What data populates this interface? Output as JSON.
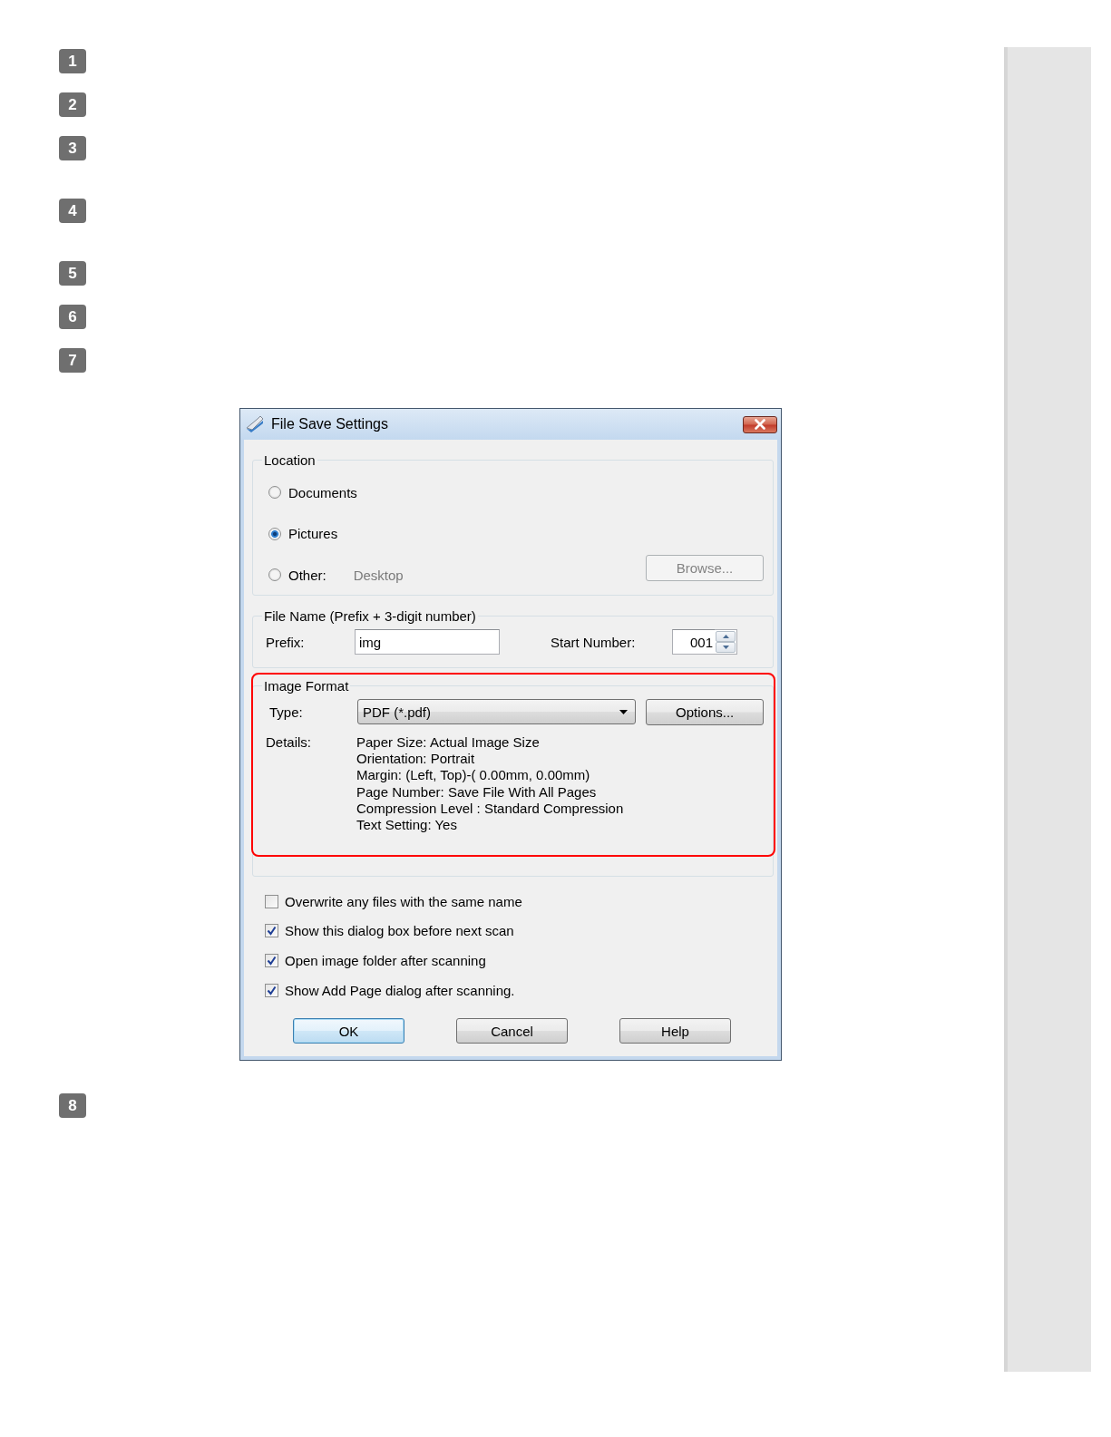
{
  "steps": [
    {
      "number": "1"
    },
    {
      "number": "2"
    },
    {
      "number": "3"
    },
    {
      "number": "4"
    },
    {
      "number": "5"
    },
    {
      "number": "6"
    },
    {
      "number": "7",
      "dialog": {
        "title": "File Save Settings",
        "location": {
          "legend": "Location",
          "options": [
            {
              "label": "Documents",
              "selected": false
            },
            {
              "label": "Pictures",
              "selected": true
            },
            {
              "label": "Other:",
              "selected": false,
              "path": "Desktop"
            }
          ],
          "browse": {
            "label": "Browse...",
            "disabled": true
          }
        },
        "file_name": {
          "legend": "File Name (Prefix + 3-digit number)",
          "prefix_label": "Prefix:",
          "prefix": "img",
          "start_label": "Start Number:",
          "start_number": "001"
        },
        "image_format": {
          "legend": "Image Format",
          "highlighted": true,
          "type_label": "Type:",
          "type": "PDF (*.pdf)",
          "options_button": "Options...",
          "details_label": "Details:",
          "details": [
            "Paper Size: Actual Image Size",
            "Orientation: Portrait",
            "Margin: (Left, Top)-( 0.00mm, 0.00mm)",
            "Page Number: Save File With All Pages",
            "Compression Level : Standard Compression",
            "Text Setting: Yes"
          ]
        },
        "checkboxes": [
          {
            "label": "Overwrite any files with the same name",
            "checked": false
          },
          {
            "label": "Show this dialog box before next scan",
            "checked": true
          },
          {
            "label": "Open image folder after scanning",
            "checked": true
          },
          {
            "label": "Show Add Page dialog after scanning.",
            "checked": true
          }
        ],
        "buttons": [
          {
            "label": "OK",
            "default": true
          },
          {
            "label": "Cancel",
            "default": false
          },
          {
            "label": "Help",
            "default": false
          }
        ]
      }
    },
    {
      "number": "8"
    }
  ]
}
